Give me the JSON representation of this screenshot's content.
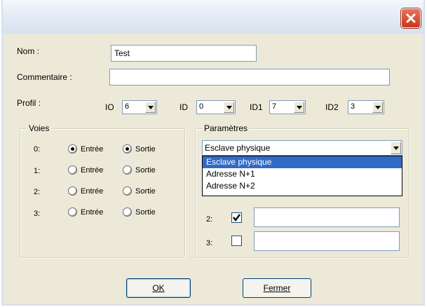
{
  "form": {
    "nom_label": "Nom :",
    "nom_value": "Test",
    "commentaire_label": "Commentaire :",
    "commentaire_value": "",
    "profil_label": "Profil :"
  },
  "profil": [
    {
      "label": "IO",
      "value": "6"
    },
    {
      "label": "ID",
      "value": "0"
    },
    {
      "label": "ID1",
      "value": "7"
    },
    {
      "label": "ID2",
      "value": "3"
    }
  ],
  "voies": {
    "title": "Voies",
    "entree_label": "Entrée",
    "sortie_label": "Sortie",
    "rows": [
      {
        "label": "0:",
        "selected": "both"
      },
      {
        "label": "1:",
        "selected": "none"
      },
      {
        "label": "2:",
        "selected": "none"
      },
      {
        "label": "3:",
        "selected": "none"
      }
    ]
  },
  "parametres": {
    "title": "Paramètres",
    "selected": "Esclave physique",
    "options": [
      "Esclave physique",
      "Adresse N+1",
      "Adresse N+2"
    ],
    "highlighted_index": 0,
    "rows": [
      {
        "label": "2:",
        "checked": true,
        "value": ""
      },
      {
        "label": "3:",
        "checked": false,
        "value": ""
      }
    ]
  },
  "buttons": {
    "ok": "OK",
    "fermer": "Fermer"
  },
  "colors": {
    "close_button": "#c8361e",
    "selection": "#316ac5",
    "dialog_bg": "#ece9d8"
  }
}
